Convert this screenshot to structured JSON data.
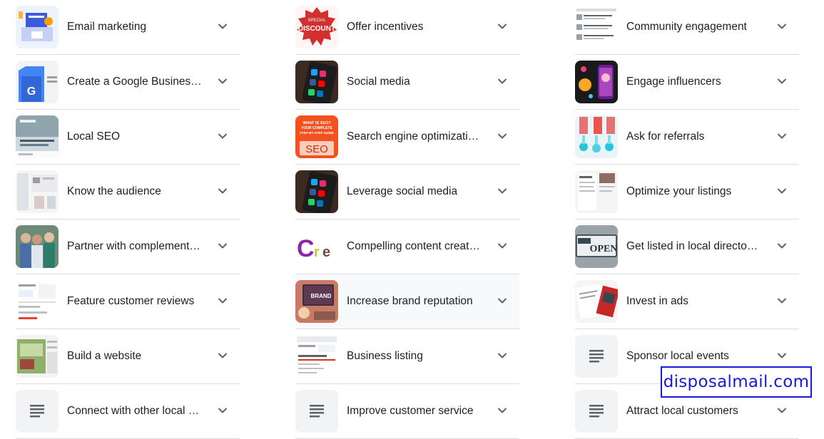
{
  "columns": [
    [
      {
        "label": "Email marketing",
        "thumb": "email-marketing-image"
      },
      {
        "label": "Create a Google Busines…",
        "thumb": "google-business-image"
      },
      {
        "label": "Local SEO",
        "thumb": "local-seo-image"
      },
      {
        "label": "Know the audience",
        "thumb": "audience-image"
      },
      {
        "label": "Partner with complement…",
        "thumb": "partners-image"
      },
      {
        "label": "Feature customer reviews",
        "thumb": "reviews-image"
      },
      {
        "label": "Build a website",
        "thumb": "website-image"
      },
      {
        "label": "Connect with other local …",
        "thumb": "document-icon"
      }
    ],
    [
      {
        "label": "Offer incentives",
        "thumb": "special-discount-image",
        "thumb_text": [
          "SPECIAL",
          "DISCOUNT"
        ]
      },
      {
        "label": "Social media",
        "thumb": "social-media-image"
      },
      {
        "label": "Search engine optimizati…",
        "thumb": "seo-guide-image",
        "thumb_text": [
          "WHAT IS SEO?",
          "YOUR COMPLETE",
          "STEP-BY-STEP GUIDE",
          "SEO"
        ]
      },
      {
        "label": "Leverage social media",
        "thumb": "social-media-image"
      },
      {
        "label": "Compelling content creat…",
        "thumb": "content-creation-image"
      },
      {
        "label": "Increase brand reputation",
        "thumb": "brand-image",
        "thumb_text": [
          "BRAND"
        ],
        "highlighted": true
      },
      {
        "label": "Business listing",
        "thumb": "business-listing-image"
      },
      {
        "label": "Improve customer service",
        "thumb": "document-icon"
      }
    ],
    [
      {
        "label": "Community engagement",
        "thumb": "community-screenshot-image"
      },
      {
        "label": "Engage influencers",
        "thumb": "influencer-image"
      },
      {
        "label": "Ask for referrals",
        "thumb": "referrals-image"
      },
      {
        "label": "Optimize your listings",
        "thumb": "listings-image"
      },
      {
        "label": "Get listed in local directo…",
        "thumb": "open-sign-image",
        "thumb_text": [
          "OPEN"
        ]
      },
      {
        "label": "Invest in ads",
        "thumb": "ads-image"
      },
      {
        "label": "Sponsor local events",
        "thumb": "document-icon"
      },
      {
        "label": "Attract local customers",
        "thumb": "document-icon"
      }
    ]
  ],
  "watermark": "disposalmail.com",
  "colors": {
    "divider": "#dadce0",
    "text": "#202124",
    "chevron": "#5f6368",
    "watermark": "#1a1ad6",
    "highlight": "#f8f9fa"
  }
}
